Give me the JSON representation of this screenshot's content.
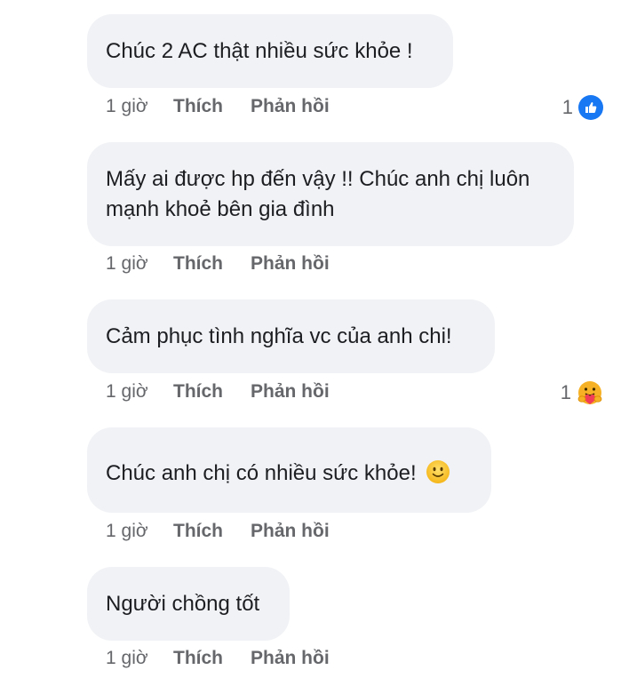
{
  "comments": [
    {
      "text": "Chúc 2 AC thật nhiều sức khỏe !",
      "time": "1 giờ",
      "like": "Thích",
      "reply": "Phản hồi",
      "reaction_count": "1",
      "reaction_icon": "like-icon"
    },
    {
      "text_line1": "Mấy ai được hp đến vậy !! Chúc anh chị luôn",
      "text_line2": "mạnh khoẻ bên gia đình",
      "time": "1 giờ",
      "like": "Thích",
      "reply": "Phản hồi"
    },
    {
      "text": "Cảm phục tình nghĩa vc của anh chi!",
      "time": "1 giờ",
      "like": "Thích",
      "reply": "Phản hồi",
      "reaction_count": "1",
      "reaction_icon": "care-icon"
    },
    {
      "text": "Chúc anh chị có nhiều sức khỏe!",
      "emoji_icon": "smiling-face-icon",
      "time": "1 giờ",
      "like": "Thích",
      "reply": "Phản hồi"
    },
    {
      "text": "Người chồng tốt",
      "time": "1 giờ",
      "like": "Thích",
      "reply": "Phản hồi"
    }
  ],
  "colors": {
    "bubble": "#f0f2f5",
    "text": "#1c1e21",
    "meta": "#65676b",
    "like_blue": "#1877f2"
  }
}
